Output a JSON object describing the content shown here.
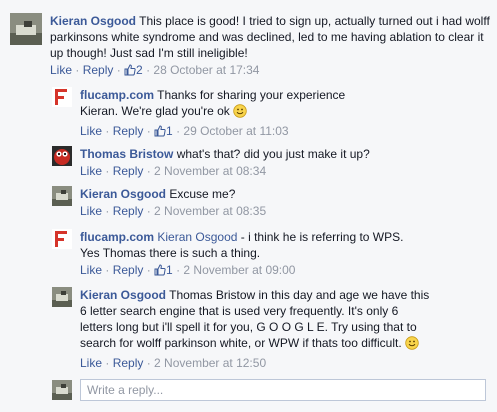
{
  "comments": [
    {
      "author": "Kieran Osgood",
      "text": " This place is good! I tried to sign up, actually turned out i had wolff parkinsons white syndrome and was declined, led to me having ablation to clear it up though! Just sad I'm still ineligible!",
      "like": "Like",
      "reply": "Reply",
      "likes": "2",
      "time": "28 October at 17:34"
    },
    {
      "author": "flucamp.com",
      "text": " Thanks for sharing your experience Kieran. We're glad you're ok",
      "like": "Like",
      "reply": "Reply",
      "likes": "1",
      "time": "29 October at 11:03"
    },
    {
      "author": "Thomas Bristow",
      "text": " what's that? did you just make it up?",
      "like": "Like",
      "reply": "Reply",
      "time": "2 November at 08:34"
    },
    {
      "author": "Kieran Osgood",
      "text": " Excuse me?",
      "like": "Like",
      "reply": "Reply",
      "time": "2 November at 08:35"
    },
    {
      "author": "flucamp.com",
      "mention": "Kieran Osgood",
      "text": " - i think he is referring to WPS. Yes Thomas there is such a thing.",
      "like": "Like",
      "reply": "Reply",
      "likes": "1",
      "time": "2 November at 09:00"
    },
    {
      "author": "Kieran Osgood",
      "text": " Thomas Bristow in this day and age we have this 6 letter search engine that is used very frequently. It's only 6 letters long but i'll spell it for you, G O O G L E. Try using that to search for wolff parkinson white, or WPW if thats too difficult.",
      "like": "Like",
      "reply": "Reply",
      "time": "2 November at 12:50"
    }
  ],
  "reply_box": {
    "placeholder": "Write a reply..."
  },
  "icons": {
    "like_count": "thumbs-up-icon",
    "smiley": "smiley-emoji-icon"
  },
  "colors": {
    "link": "#3b5998",
    "meta": "#9197a3",
    "text": "#141823",
    "background": "#f6f7f9"
  }
}
